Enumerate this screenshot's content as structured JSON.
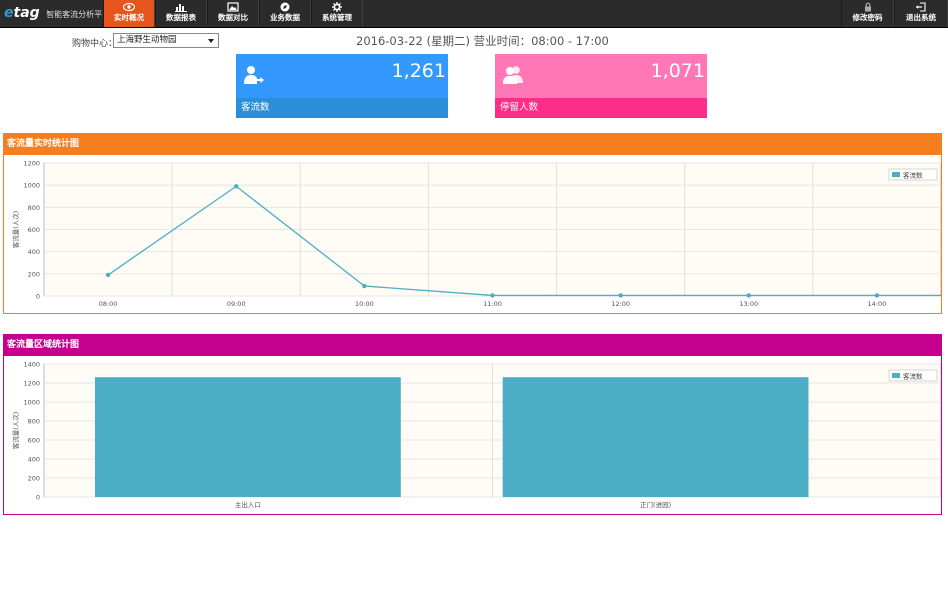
{
  "app": {
    "logo_e": "e",
    "logo_rest": "tag",
    "subtitle": "智能客流分析平台"
  },
  "nav": {
    "items": [
      {
        "label": "实时概况",
        "icon": "eye-icon",
        "active": true
      },
      {
        "label": "数据报表",
        "icon": "bar-chart-icon",
        "active": false
      },
      {
        "label": "数据对比",
        "icon": "image-icon",
        "active": false
      },
      {
        "label": "业务数据",
        "icon": "compass-icon",
        "active": false
      },
      {
        "label": "系统管理",
        "icon": "gear-icon",
        "active": false
      }
    ],
    "right": [
      {
        "label": "修改密码",
        "icon": "lock-icon"
      },
      {
        "label": "退出系统",
        "icon": "logout-icon"
      }
    ]
  },
  "header": {
    "mall_label": "购物中心：",
    "mall_selected": "上海野生动物园",
    "date_line": "2016-03-22 (星期二)   营业时间：08:00 - 17:00"
  },
  "kpis": [
    {
      "value": "1,261",
      "label": "客流数",
      "icon": "user-enter-icon",
      "color": "#3399ff"
    },
    {
      "value": "1,071",
      "label": "停留人数",
      "icon": "users-icon",
      "color": "#ff77b4"
    }
  ],
  "charts": {
    "line_title": "客流量实时统计图",
    "bar_title": "客流量区域统计图"
  },
  "chart_data": [
    {
      "type": "line",
      "title": "客流量实时统计图",
      "ylabel": "客流量(人次)",
      "ylim": [
        0,
        1200
      ],
      "yticks": [
        0,
        200,
        400,
        600,
        800,
        1000,
        1200
      ],
      "x": [
        "08:00",
        "09:00",
        "10:00",
        "11:00",
        "12:00",
        "13:00",
        "14:00"
      ],
      "series": [
        {
          "name": "客流数",
          "values": [
            190,
            990,
            90,
            5,
            5,
            5,
            5
          ],
          "color": "#4baec5"
        }
      ],
      "legend": "top-right",
      "grid": true
    },
    {
      "type": "bar",
      "title": "客流量区域统计图",
      "ylabel": "客流量(人次)",
      "ylim": [
        0,
        1400
      ],
      "yticks": [
        0,
        200,
        400,
        600,
        800,
        1000,
        1200,
        1400
      ],
      "categories": [
        "主出入口",
        "正门(进园)"
      ],
      "series": [
        {
          "name": "客流数",
          "values": [
            1261,
            1261
          ],
          "color": "#4baec5"
        }
      ],
      "legend": "top-right",
      "grid": true
    }
  ]
}
